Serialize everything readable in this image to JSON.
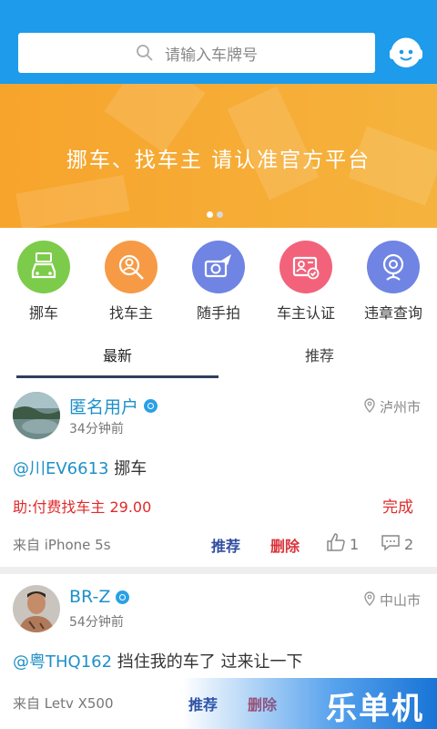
{
  "search": {
    "placeholder": "请输入车牌号"
  },
  "banner": {
    "text": "挪车、找车主  请认准官方平台"
  },
  "quick_actions": [
    {
      "label": "挪车",
      "color": "#7DCB4A",
      "icon": "temporary-parking-car-icon"
    },
    {
      "label": "找车主",
      "color": "#F79A45",
      "icon": "search-person-icon"
    },
    {
      "label": "随手拍",
      "color": "#6F84E3",
      "icon": "camera-plane-icon"
    },
    {
      "label": "车主认证",
      "color": "#F2637B",
      "icon": "id-card-verified-icon"
    },
    {
      "label": "违章查询",
      "color": "#6F84E3",
      "icon": "webcam-icon"
    }
  ],
  "tabs": [
    {
      "label": "最新"
    },
    {
      "label": "推荐"
    }
  ],
  "posts": [
    {
      "username": "匿名用户",
      "time": "34分钟前",
      "city": "泸州市",
      "plate": "@川EV6613",
      "message": " 挪车",
      "reward": "助:付费找车主 29.00",
      "status": "完成",
      "source": "来自  iPhone 5s",
      "recommend": "推荐",
      "delete": "删除",
      "likes": "1",
      "comments": "2"
    },
    {
      "username": "BR-Z",
      "time": "54分钟前",
      "city": "中山市",
      "plate": "@粤THQ162",
      "message": " 挡住我的车了 过来让一下",
      "source": "来自  Letv X500",
      "recommend": "推荐",
      "delete": "删除"
    }
  ],
  "watermark": "乐单机"
}
